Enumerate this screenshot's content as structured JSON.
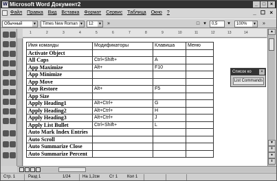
{
  "window": {
    "title": "Microsoft Word  Документ2",
    "controls": [
      "_",
      "□",
      "×"
    ]
  },
  "menu": {
    "items": [
      "Файл",
      "Правка",
      "Вид",
      "Вставка",
      "Формат",
      "Сервис",
      "Таблица",
      "Окно",
      "?"
    ],
    "doc_controls": "_ ☐ ×"
  },
  "toolbar": {
    "style_value": "Обычный",
    "font_value": "Times New Roman",
    "size_value": "12",
    "indent_value": "0,5",
    "zoom_value": "100%"
  },
  "ruler": {
    "ticks": [
      "1",
      "2",
      "3",
      "4",
      "5",
      "6",
      "7",
      "8",
      "9",
      "10",
      "11",
      "12",
      "13",
      "14"
    ]
  },
  "table": {
    "headers": [
      "Имя команды",
      "Модификаторы",
      "Клавиша",
      "Меню"
    ],
    "rows": [
      [
        "Activate Object",
        "",
        "",
        ""
      ],
      [
        "All Caps",
        "Ctrl+Shift+",
        "A",
        ""
      ],
      [
        "App Maximize",
        "Alt+",
        "F10",
        ""
      ],
      [
        "App Minimize",
        "",
        "",
        ""
      ],
      [
        "App Move",
        "",
        "",
        ""
      ],
      [
        "App Restore",
        "Alt+",
        "F5",
        ""
      ],
      [
        "App Size",
        "",
        "",
        ""
      ],
      [
        "Apply Heading1",
        "Alt+Ctrl+",
        "G",
        ""
      ],
      [
        "Apply Heading2",
        "Alt+Ctrl+",
        "H",
        ""
      ],
      [
        "Apply Heading3",
        "Alt+Ctrl+",
        "J",
        ""
      ],
      [
        "Apply List Bullet",
        "Ctrl+Shift+",
        "L",
        ""
      ],
      [
        "Auto Mark Index Entries",
        "",
        "",
        ""
      ],
      [
        "Auto Scroll",
        "",
        "",
        ""
      ],
      [
        "Auto Summarize Close",
        "",
        "",
        ""
      ],
      [
        "Auto Summarize Percent",
        "",
        "",
        ""
      ]
    ]
  },
  "floating_toolbar": {
    "title": "Список ко",
    "close": "×",
    "button_label": "List Commands"
  },
  "status": {
    "page": "Стр. 1",
    "section": "Разд 1",
    "pages": "1/24",
    "position": "На 1,2см",
    "line": "Ст 1",
    "column": "Кол 1"
  }
}
